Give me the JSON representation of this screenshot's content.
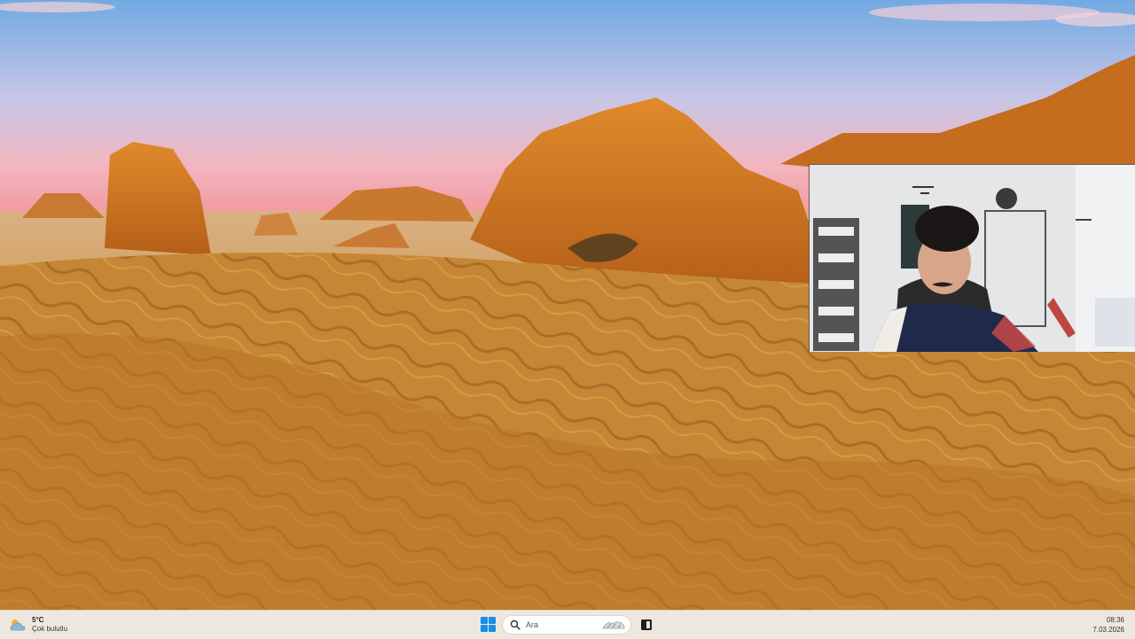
{
  "desktop": {
    "wallpaper": "desert-landscape"
  },
  "webcam": {
    "label": "webcam-overlay"
  },
  "taskbar": {
    "weather": {
      "temperature": "5°C",
      "description": "Çok bulutlu",
      "icon": "cloud-sun-icon"
    },
    "start_icon": "windows-start-icon",
    "search": {
      "placeholder": "Ara",
      "icon": "search-icon"
    },
    "apps": [
      {
        "icon": "task-view-icon"
      }
    ],
    "clock": {
      "time": "08:36",
      "date": "7.03.2026"
    }
  },
  "colors": {
    "accent": "#1a8ee6",
    "taskbar_bg": "#eee7df"
  }
}
